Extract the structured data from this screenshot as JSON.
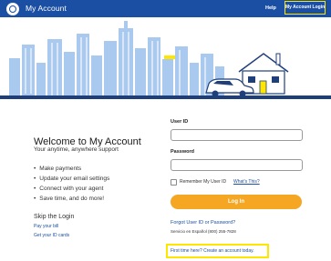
{
  "header": {
    "title": "My Account",
    "help_label": "Help",
    "login_label": "My Account Login"
  },
  "welcome": {
    "title": "Welcome to My Account",
    "tagline": "Your anytime, anywhere support",
    "bullets": [
      "Make payments",
      "Update your email settings",
      "Connect with your agent",
      "Save time, and do more!"
    ],
    "skip_title": "Skip the Login",
    "skip_links": [
      "Pay your bill",
      "Get your ID cards"
    ]
  },
  "form": {
    "user_id_label": "User ID",
    "user_id_value": "",
    "password_label": "Password",
    "password_value": "",
    "remember_label": "Remember My User ID",
    "remember_checked": false,
    "whats_this": "What's This?",
    "login_button": "Log In",
    "forgot_link": "Forgot User ID or Password?",
    "espanol": "Servicio en Español (800) 255-7828",
    "create_link": "First time here? Create an account today."
  },
  "icons": {
    "logo": "allstate-hands-logo-icon"
  },
  "colors": {
    "header_bg": "#1b4fa3",
    "highlight": "#ffe600",
    "button": "#f5a623",
    "link": "#1b4fa3",
    "skyline": "#a9c9ee"
  }
}
